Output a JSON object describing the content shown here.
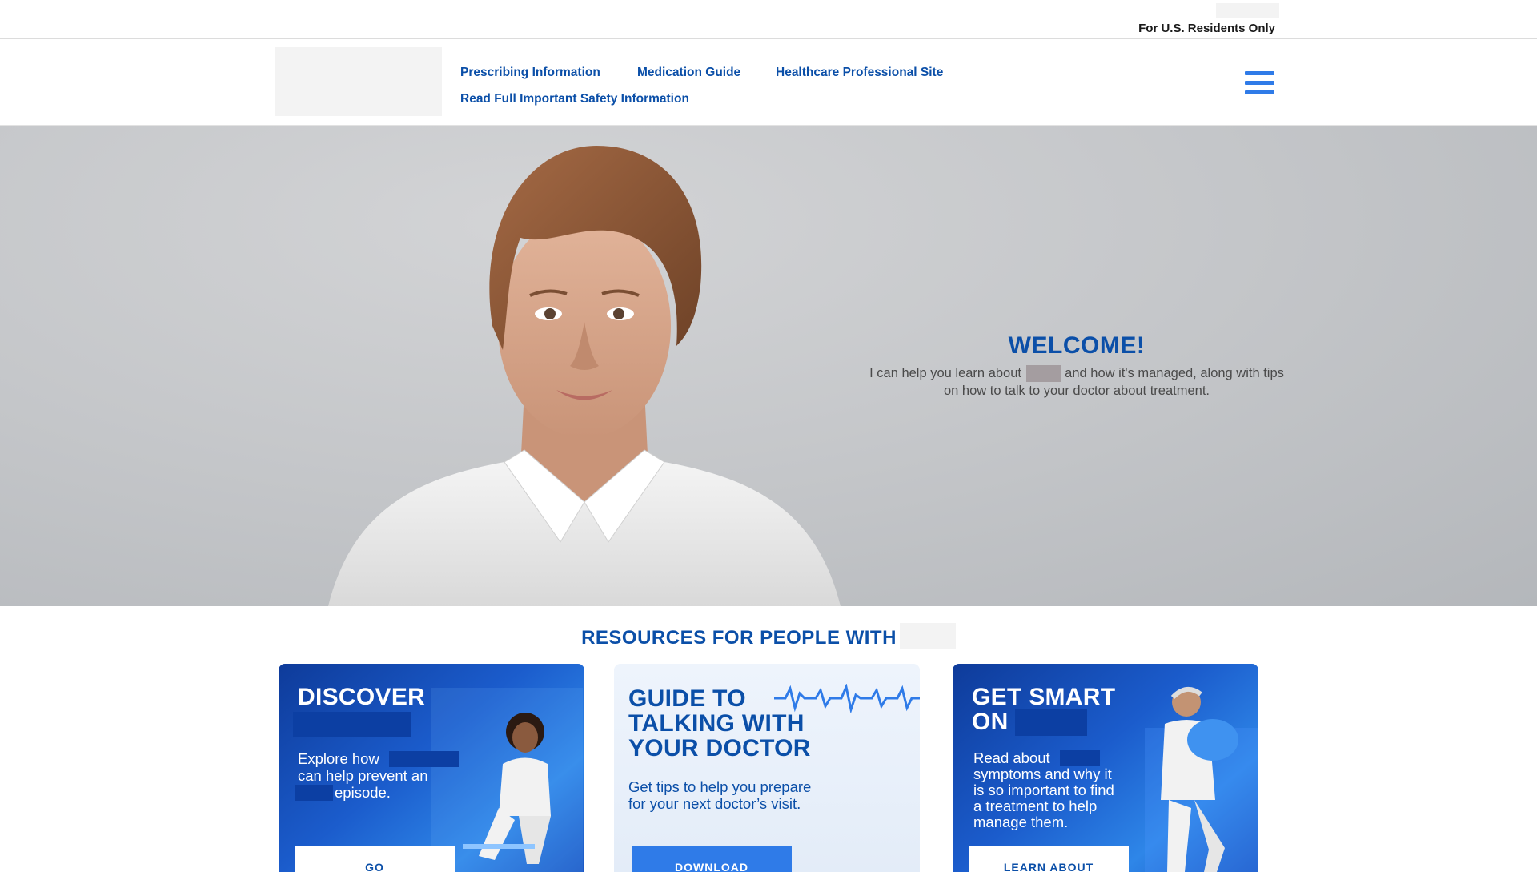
{
  "topbar": {
    "residents_label": "For U.S. Residents Only"
  },
  "nav": {
    "links": [
      {
        "label": "Prescribing Information"
      },
      {
        "label": "Medication Guide"
      },
      {
        "label": "Healthcare Professional Site"
      },
      {
        "label": "Read Full Important Safety Information"
      }
    ],
    "menu_icon": "hamburger-menu-icon"
  },
  "hero": {
    "welcome_title": "WELCOME!",
    "welcome_text_before": "I can help you learn about",
    "welcome_text_after": "and how it's managed, along with tips on how to talk to your doctor about treatment."
  },
  "resources": {
    "title": "RESOURCES FOR PEOPLE WITH",
    "cards": [
      {
        "title": "DISCOVER",
        "text_1": "Explore how",
        "text_2": "can help prevent an",
        "text_3": "episode.",
        "button": "GO"
      },
      {
        "title_1": "GUIDE TO",
        "title_2": "TALKING WITH",
        "title_3": "YOUR DOCTOR",
        "text_1": "Get tips to help you prepare",
        "text_2": "for your next doctor’s visit.",
        "button": "DOWNLOAD"
      },
      {
        "title_1": "GET SMART",
        "title_2": "ON",
        "text_1": "Read about",
        "text_2": "symptoms and why it",
        "text_3": "is so important to find",
        "text_4": "a treatment to help",
        "text_5": "manage them.",
        "button": "LEARN ABOUT"
      }
    ]
  },
  "colors": {
    "brand_blue": "#0b4fa8",
    "accent_blue": "#2f7be8"
  }
}
